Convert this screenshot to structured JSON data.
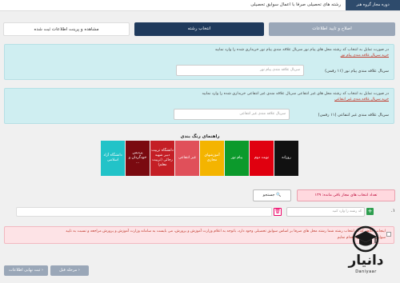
{
  "topbar": {
    "badge": "دوره مجاز گروه هنر",
    "crumb": "رشته های تحصیلی صرفا با اعمال سوابق تحصیلی"
  },
  "tabs": {
    "done": "اصلاح و تایید اطلاعات",
    "active": "انتخاب رشته",
    "pending": "مشاهده و پرینت اطلاعات ثبت شده"
  },
  "payam_noor": {
    "desc": "در صورت تمایل به انتخاب کد رشته محل های پیام نور سریال علاقه مندی پیام نور خریداری شده را وارد نمایید",
    "link": "خرید سریال علاقه مندی پیام نور",
    "label": "سریال علاقه مندی پیام نور (۱۱ رقمی)",
    "placeholder": "سریال علاقه مندی پیام نور"
  },
  "non_profit": {
    "desc": "در صورت تمایل به انتخاب کد رشته محل های غیر انتفاعی سریال علاقه مندی غیر انتفاعی خریداری شده را وارد نمایید",
    "link": "خرید سریال علاقه مندی غیر انتفاعی",
    "label": "سریال علاقه مندی غیر انتفاعی (۱۱ رقمی)",
    "placeholder": "سریال علاقه مندی غیر انتفاعی"
  },
  "guide": {
    "title": "راهنمای رنگ بندی",
    "items": [
      {
        "label": "روزانه",
        "bg": "#111111",
        "fg": "#ffffff"
      },
      {
        "label": "نوبت دوم",
        "bg": "#e0000f",
        "fg": "#ffffff"
      },
      {
        "label": "پیام نور",
        "bg": "#0c9a2c",
        "fg": "#ffffff"
      },
      {
        "label": "آموزشهای مجازی",
        "bg": "#f4b400",
        "fg": "#ffffff"
      },
      {
        "label": "غیر انتفاعی",
        "bg": "#e0505a",
        "fg": "#ffffff"
      },
      {
        "label": "دانشگاه تربیت دبیر شهید رجائی (تربیت معلم)",
        "bg": "#c41e25",
        "fg": "#ffffff"
      },
      {
        "label": "پردیس خودگردان و ...",
        "bg": "#7a0a10",
        "fg": "#ffffff"
      },
      {
        "label": "دانشگاه آزاد اسلامی",
        "bg": "#22c3c8",
        "fg": "#ffffff"
      }
    ]
  },
  "remaining": "تعداد انتخاب های مجاز باقی مانده: ۱۴۹",
  "search_label": "جستجو",
  "row": {
    "index": "۱.",
    "add": "+",
    "code_placeholder": "کد رشته را وارد کنید",
    "delete": "🗑"
  },
  "warning": {
    "line1": "اینجانب آگاهم که در انتخاب رشته شما رشته محل های صرفا بر اساس سوابق تحصیلی وجود دارد، باتوجه به اعلام وزارت آموزش و پرورش، می بایست به سامانه وزارت آموزش و پرورش مراجعه و نسبت به تایید",
    "line2": "سوابق تحصیلی خود اقدام نمایم"
  },
  "buttons": {
    "prev": "مرحله قبل",
    "final": "ثبت نهایی اطلاعات"
  },
  "watermark": {
    "name": "دانیار",
    "sub": "Daniyaar"
  }
}
